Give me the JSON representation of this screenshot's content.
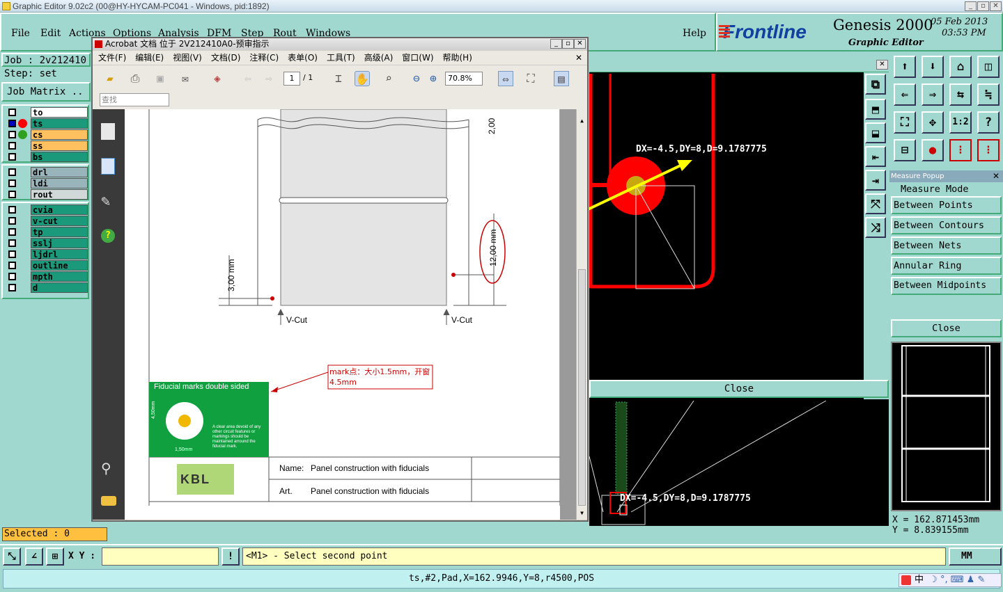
{
  "app_title": "Graphic Editor 9.02c2 (00@HY-HYCAM-PC041 - Windows, pid:1892)",
  "menu": [
    "File",
    "Edit",
    "Actions",
    "Options",
    "Analysis",
    "DFM",
    "Step",
    "Rout",
    "Windows"
  ],
  "help": "Help",
  "brand": {
    "logo": "Frontline",
    "product": "Genesis 2000",
    "subtitle": "Graphic Editor",
    "date": "05 Feb 2013",
    "time": "03:53 PM"
  },
  "job": {
    "label": "Job : 2v212410",
    "step": "Step: set",
    "matrix": "Job Matrix .."
  },
  "layers_g1": [
    {
      "name": "to",
      "color": "#ffffff",
      "dot": ""
    },
    {
      "name": "ts",
      "color": "#1a9a7a",
      "dot": "#ff0000"
    },
    {
      "name": "cs",
      "color": "#ffc060",
      "dot": "#30a020"
    },
    {
      "name": "ss",
      "color": "#ffc060",
      "dot": ""
    },
    {
      "name": "bs",
      "color": "#1a9a7a",
      "dot": ""
    }
  ],
  "layers_g2": [
    {
      "name": "drl",
      "color": "#9ab4bc"
    },
    {
      "name": "ldi",
      "color": "#9ab4bc"
    },
    {
      "name": "rout",
      "color": "#d0d8d8"
    }
  ],
  "layers_g3": [
    {
      "name": "cvia"
    },
    {
      "name": "v-cut"
    },
    {
      "name": "tp"
    },
    {
      "name": "sslj"
    },
    {
      "name": "ljdrl"
    },
    {
      "name": "outline"
    },
    {
      "name": "mpth"
    },
    {
      "name": "d"
    }
  ],
  "selected": "Selected : 0",
  "acrobat": {
    "title": "Acrobat 文档 位于 2V212410A0-预审指示",
    "menu": [
      "文件(F)",
      "编辑(E)",
      "视图(V)",
      "文档(D)",
      "注释(C)",
      "表单(O)",
      "工具(T)",
      "高级(A)",
      "窗口(W)",
      "帮助(H)"
    ],
    "page": "1",
    "pages": "/ 1",
    "zoom": "70.8%",
    "find_placeholder": "查找",
    "drawing": {
      "dim_top": "2,00",
      "dim_mid": "12,00 mm",
      "dim_left": "3,00 mm",
      "vcut": "V-Cut",
      "note": "mark点：大小1.5mm，开窗4.5mm",
      "fid_title": "Fiducial marks double sided",
      "fid_text": "A clear area devoid of any other circuit features or markings should be maintained arround the fiducial mark.",
      "fid_dim1": "4,50mm",
      "fid_dim2": "1,50mm",
      "name_label": "Name:",
      "name_val": "Panel construction with fiducials",
      "art_label": "Art.",
      "art_val": "Panel construction with fiducials",
      "logo_text": "KBL"
    }
  },
  "measure": {
    "readout": "DX=-4.5,DY=8,D=9.1787775",
    "close": "Close"
  },
  "measure_popup": {
    "title": "Measure Popup",
    "mode": "Measure Mode",
    "items": [
      "Between Points",
      "Between Contours",
      "Between Nets",
      "Annular Ring",
      "Between Midpoints"
    ],
    "close": "Close"
  },
  "coords": {
    "x": "X = 162.871453mm",
    "y": "Y = 8.839155mm"
  },
  "status": {
    "xy_label": "X Y :",
    "excl": "!",
    "prompt": "<M1> - Select second point",
    "units": "MM"
  },
  "bottom_info": "ts,#2,Pad,X=162.9946,Y=8,r4500,POS",
  "tray": {
    "ime": "中"
  },
  "colors": {
    "panel": "#a0d8d0",
    "accent_red": "#ff0000",
    "yellow": "#ffff00"
  }
}
